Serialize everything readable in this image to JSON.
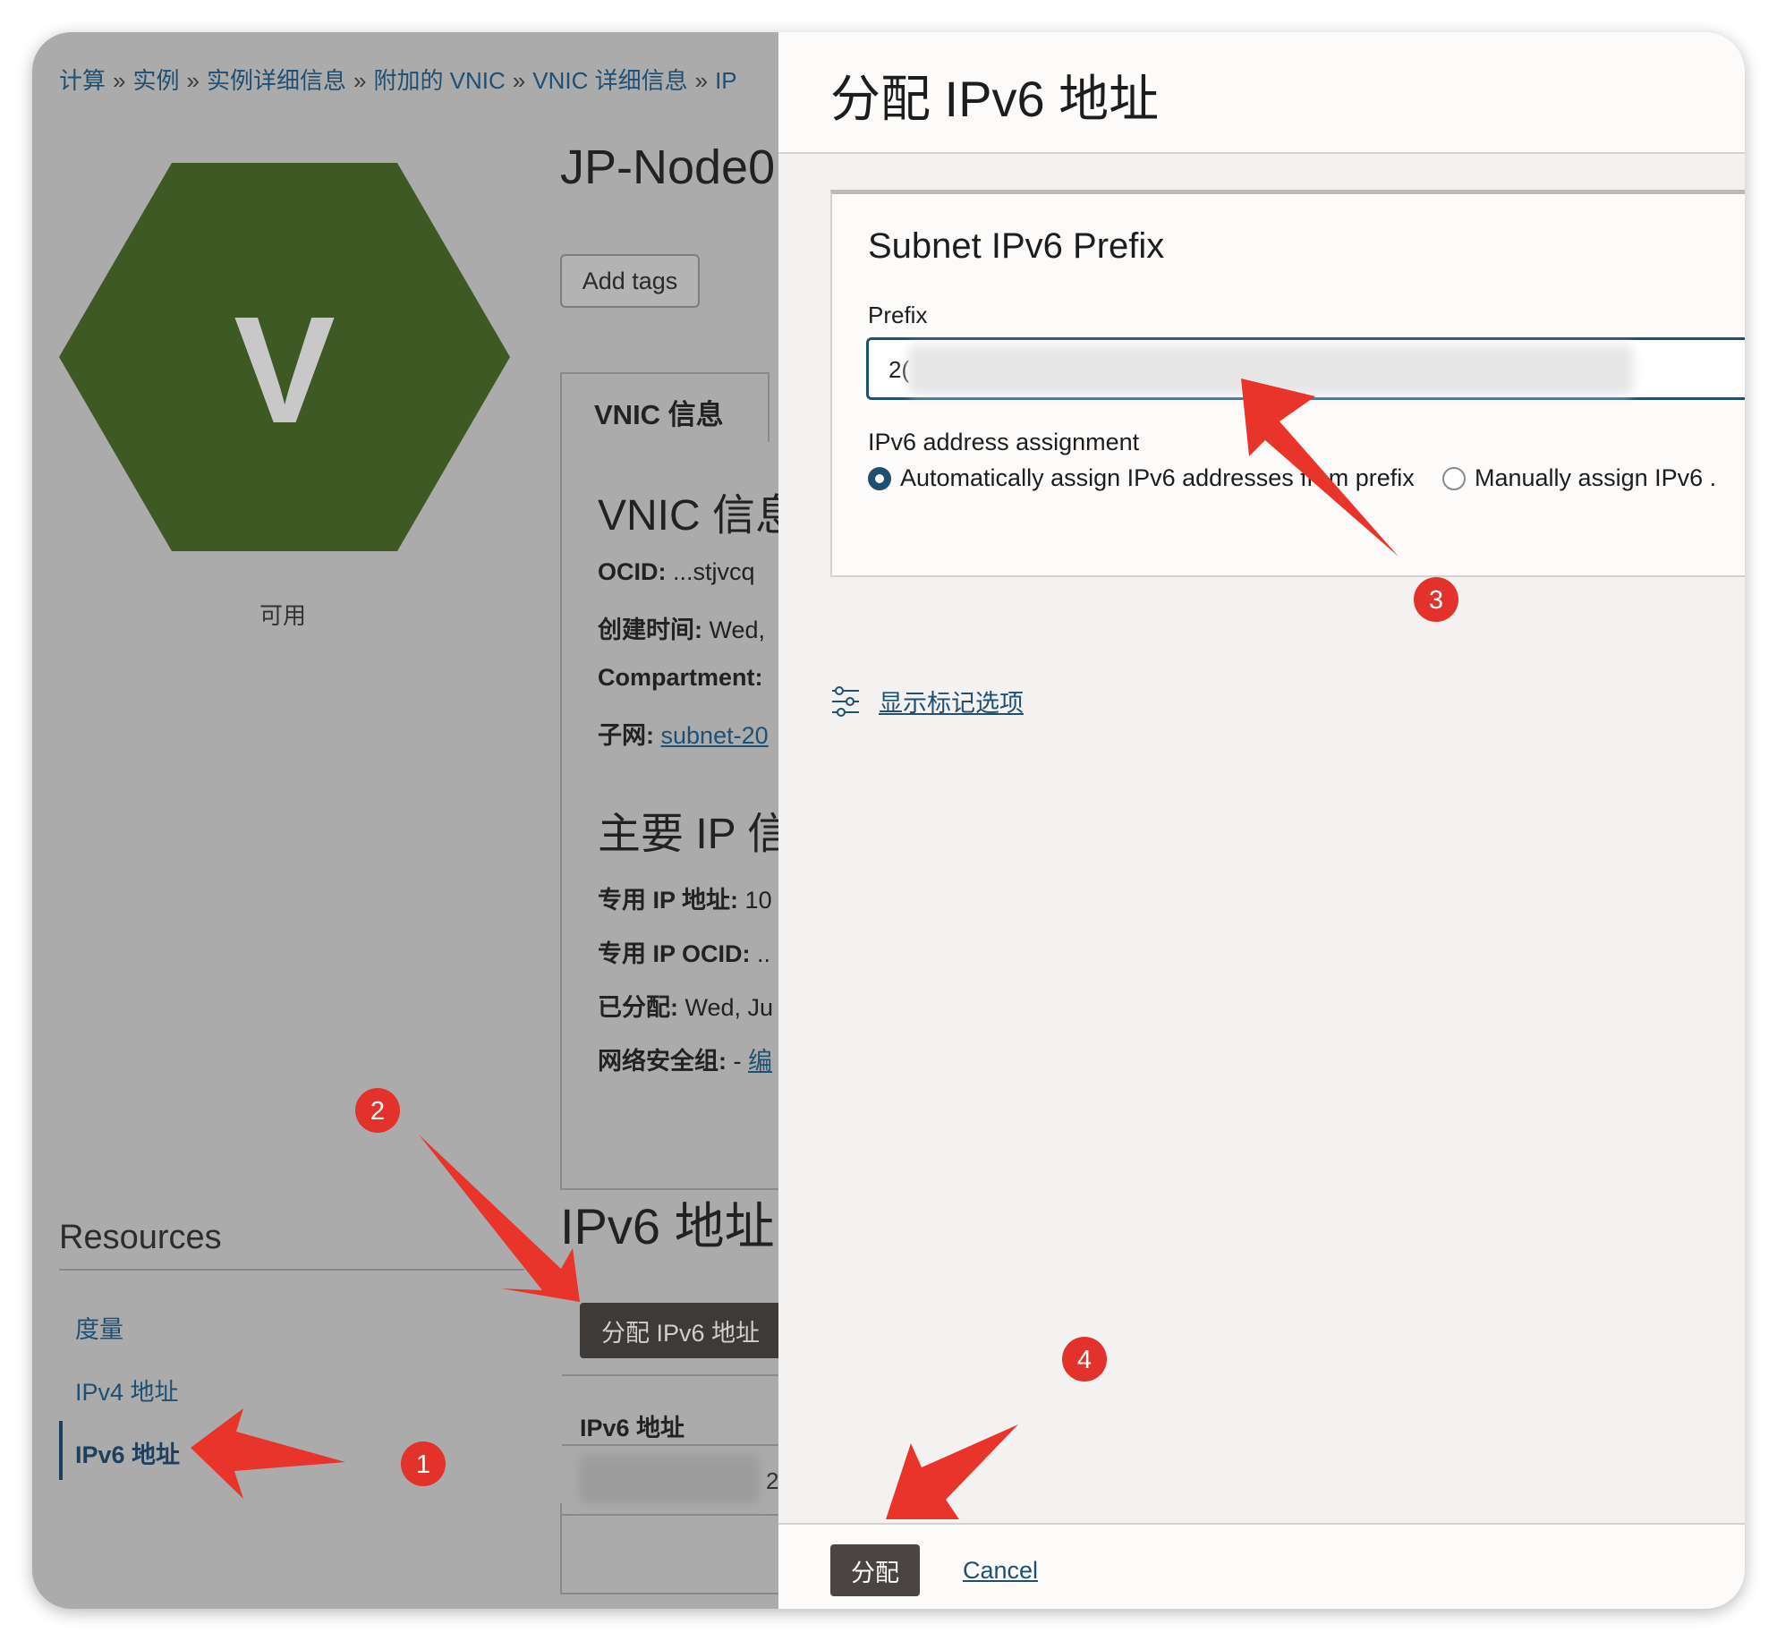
{
  "breadcrumb": {
    "items": [
      "计算",
      "实例",
      "实例详细信息",
      "附加的 VNIC",
      "VNIC 详细信息",
      "IP"
    ],
    "separator": "»"
  },
  "instance": {
    "avatar_letter": "V",
    "status": "可用",
    "name": "JP-Node0",
    "add_tags_label": "Add tags"
  },
  "vnic": {
    "tab_label": "VNIC 信息",
    "section_title": "VNIC 信息",
    "ocid_label": "OCID:",
    "ocid_value": "...stjvcq",
    "created_label": "创建时间:",
    "created_value": "Wed,",
    "compartment_label": "Compartment:",
    "subnet_label": "子网:",
    "subnet_value": "subnet-20",
    "primary_ip_title": "主要 IP 信",
    "private_ip_label": "专用 IP 地址:",
    "private_ip_value": "10",
    "private_ocid_label": "专用 IP OCID:",
    "private_ocid_value": "..",
    "assigned_label": "已分配:",
    "assigned_value": "Wed, Ju",
    "nsg_label": "网络安全组:",
    "nsg_value": "- ",
    "nsg_link": "编"
  },
  "ipv6_section": {
    "title": "IPv6 地址",
    "assign_button": "分配 IPv6 地址",
    "col_header": "IPv6 地址",
    "row_prefix": "2",
    "row_suffix": "2"
  },
  "resources": {
    "title": "Resources",
    "items": [
      "度量",
      "IPv4 地址",
      "IPv6 地址"
    ],
    "active_index": 2
  },
  "dialog": {
    "title": "分配 IPv6 地址",
    "card_title": "Subnet IPv6 Prefix",
    "prefix_label": "Prefix",
    "prefix_value": "2(",
    "assignment_label": "IPv6 address assignment",
    "option_auto": "Automatically assign IPv6 addresses from prefix",
    "option_manual": "Manually assign IPv6 .",
    "selected_option": "auto",
    "show_tags_link": "显示标记选项",
    "submit_label": "分配",
    "cancel_label": "Cancel"
  },
  "annotations": {
    "badges": [
      "1",
      "2",
      "3",
      "4"
    ],
    "color": "#e3322b"
  },
  "colors": {
    "link": "#1f4f73",
    "avatar_green": "#3f5925",
    "primary_button": "#4a4543",
    "overlay_gray": "#ababab"
  }
}
